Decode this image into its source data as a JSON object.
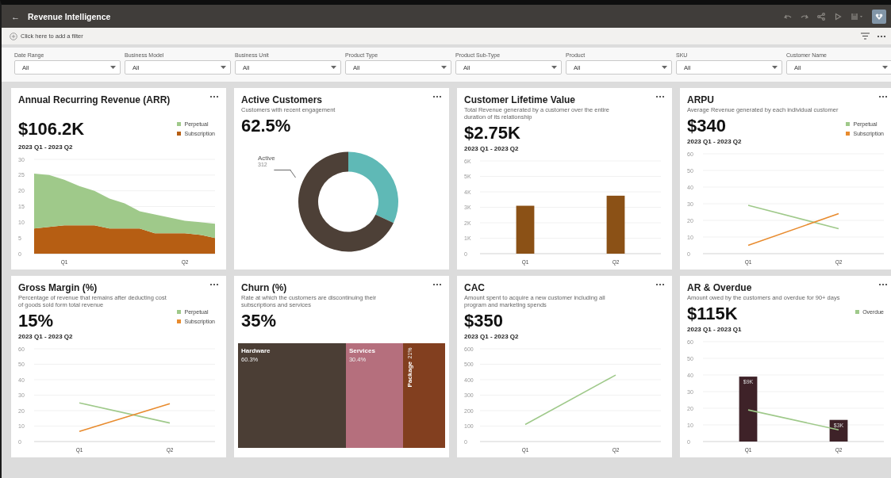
{
  "header": {
    "back": "←",
    "title": "Revenue Intelligence"
  },
  "filter_bar": {
    "add_filter": "Click here to add a filter"
  },
  "filters": [
    {
      "label": "Date Range",
      "value": "All"
    },
    {
      "label": "Business Model",
      "value": "All"
    },
    {
      "label": "Business Unit",
      "value": "All"
    },
    {
      "label": "Product Type",
      "value": "All"
    },
    {
      "label": "Product Sub-Type",
      "value": "All"
    },
    {
      "label": "Product",
      "value": "All"
    },
    {
      "label": "SKU",
      "value": "All"
    },
    {
      "label": "Customer Name",
      "value": "All"
    }
  ],
  "cards": [
    {
      "title": "Annual Recurring Revenue (ARR)",
      "value": "$106.2K",
      "period": "2023 Q1 - 2023 Q2",
      "chart_data": {
        "type": "area",
        "stacked": true,
        "grid": true,
        "categories": [
          null,
          null,
          "Q1",
          null,
          null,
          null,
          null,
          null,
          null,
          null,
          "Q2",
          null,
          null
        ],
        "ylim": [
          0,
          30
        ],
        "yticks": [
          0,
          5,
          10,
          15,
          20,
          25,
          30
        ],
        "series": [
          {
            "name": "Subscription",
            "color": "#b65e13",
            "values": [
              8,
              8.5,
              9,
              9,
              9,
              8,
              8,
              8,
              6.5,
              6.5,
              6.5,
              6,
              5
            ]
          },
          {
            "name": "Perpetual",
            "color": "#9fc98a",
            "values": [
              17.5,
              16.5,
              14.5,
              12.5,
              11,
              9.5,
              8,
              5.5,
              6,
              5,
              4,
              4,
              4.5
            ]
          }
        ]
      }
    },
    {
      "title": "Active Customers",
      "subtitle": "Customers with recent engagement",
      "value": "62.5%",
      "callout": {
        "label": "Active",
        "value": "312"
      },
      "chart_data": {
        "type": "donut",
        "values": [
          32,
          68
        ],
        "colors": [
          "#5fb9b6",
          "#4d4037"
        ]
      }
    },
    {
      "title": "Customer Lifetime Value",
      "subtitle": "Total Revenue generated by a customer over the entire duration of its relationship",
      "value": "$2.75K",
      "period": "2023 Q1 - 2023 Q2",
      "chart_data": {
        "type": "bar",
        "grid": true,
        "categories": [
          "Q1",
          "Q2"
        ],
        "ylim": [
          0,
          6000
        ],
        "yticks": [
          {
            "value": 0,
            "label": "0"
          },
          {
            "value": 1000,
            "label": "1K"
          },
          {
            "value": 2000,
            "label": "2K"
          },
          {
            "value": 3000,
            "label": "3K"
          },
          {
            "value": 4000,
            "label": "4K"
          },
          {
            "value": 5000,
            "label": "5K"
          },
          {
            "value": 6000,
            "label": "6K"
          }
        ],
        "series": [
          {
            "color": "#8b5116",
            "values": [
              3100,
              3750
            ]
          }
        ]
      }
    },
    {
      "title": "ARPU",
      "subtitle": "Average Revenue generated by each individual customer",
      "value": "$340",
      "period": "2023 Q1 - 2023 Q2",
      "chart_data": {
        "type": "line",
        "grid": true,
        "categories": [
          "Q1",
          "Q2"
        ],
        "ylim": [
          0,
          60
        ],
        "yticks": [
          0,
          10,
          20,
          30,
          40,
          50,
          60
        ],
        "series": [
          {
            "name": "Perpetual",
            "color": "#9fc98a",
            "values": [
              29,
              15
            ]
          },
          {
            "name": "Subscription",
            "color": "#e88b2e",
            "values": [
              5,
              24
            ]
          }
        ]
      }
    },
    {
      "title": "Gross Margin (%)",
      "subtitle": "Percentage of revenue that remains after deducting cost of goods sold form total revenue",
      "value": "15%",
      "period": "2023 Q1 - 2023 Q2",
      "chart_data": {
        "type": "line",
        "grid": true,
        "categories": [
          "Q1",
          "Q2"
        ],
        "ylim": [
          0,
          60
        ],
        "yticks": [
          0,
          10,
          20,
          30,
          40,
          50,
          60
        ],
        "series": [
          {
            "name": "Perpetual",
            "color": "#9fc98a",
            "values": [
              25,
              12
            ]
          },
          {
            "name": "Subscription",
            "color": "#e88b2e",
            "values": [
              6.5,
              24.5
            ]
          }
        ]
      }
    },
    {
      "title": "Churn (%)",
      "subtitle": "Rate at which the customers are discontinuing their subscriptions and services",
      "value": "35%",
      "treemap": [
        {
          "label": "Hardware",
          "value": "60.3%",
          "color": "#4b3e35",
          "kind": "horizontal"
        },
        {
          "label": "Services",
          "value": "30.4%",
          "color": "#b56f7d",
          "kind": "horizontal"
        },
        {
          "label": "Package",
          "value": "21%",
          "color": "#823f1f",
          "kind": "vertical"
        }
      ]
    },
    {
      "title": "CAC",
      "subtitle": "Amount spent to acquire a new customer including all program and marketing spends",
      "value": "$350",
      "period": "2023 Q1 - 2023 Q2",
      "chart_data": {
        "type": "line",
        "grid": true,
        "categories": [
          "Q1",
          "Q2"
        ],
        "ylim": [
          0,
          600
        ],
        "yticks": [
          0,
          100,
          200,
          300,
          400,
          500,
          600
        ],
        "series": [
          {
            "color": "#9fc98a",
            "values": [
              110,
              430
            ]
          }
        ]
      }
    },
    {
      "title": "AR & Overdue",
      "subtitle": "Amount owed by the customers and overdue for 90+ days",
      "value": "$115K",
      "period": "2023 Q1 - 2023 Q1",
      "chart_data": {
        "type": "bar",
        "grid": true,
        "categories": [
          "Q1",
          "Q2"
        ],
        "ylim": [
          0,
          60
        ],
        "yticks": [
          0,
          10,
          20,
          30,
          40,
          50,
          60
        ],
        "value_labels": [
          "$9K",
          "$3K"
        ],
        "series": [
          {
            "color": "#3e2228",
            "values": [
              39,
              13
            ]
          },
          {
            "name": "Overdue",
            "type": "line",
            "color": "#9fc98a",
            "values": [
              19,
              7
            ]
          }
        ]
      }
    }
  ]
}
